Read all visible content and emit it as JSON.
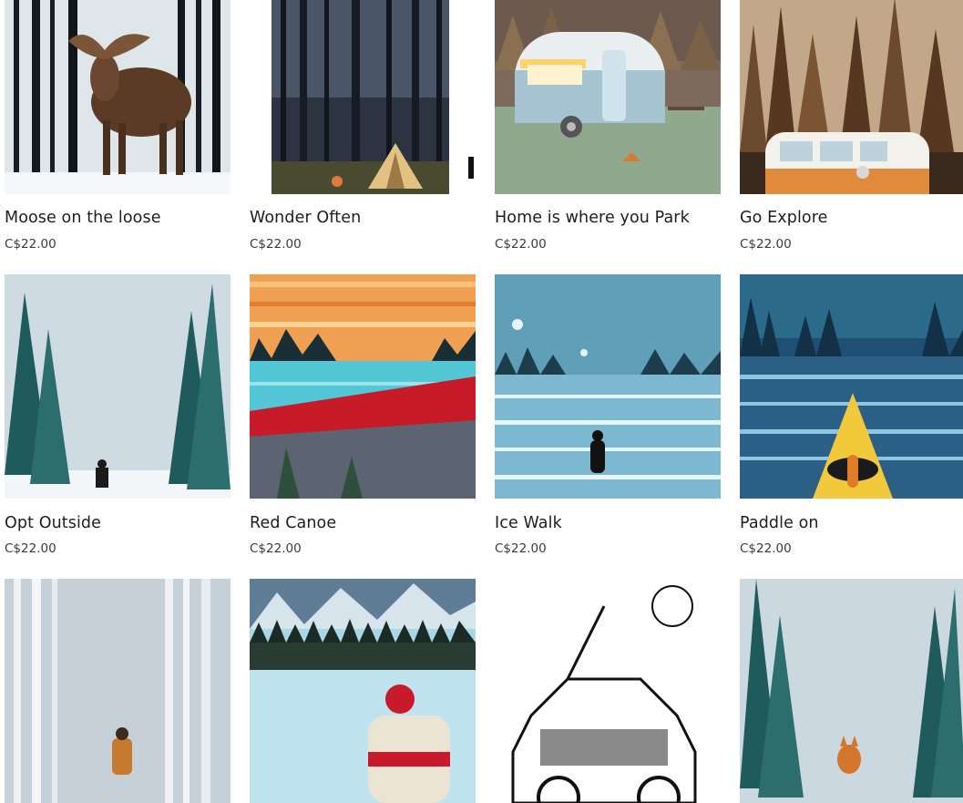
{
  "currency_price": "C$22.00",
  "products": [
    {
      "title": "Moose on the loose",
      "price": "C$22.00",
      "art": "moose"
    },
    {
      "title": "Wonder Often",
      "price": "C$22.00",
      "art": "tent"
    },
    {
      "title": "Home is where you Park",
      "price": "C$22.00",
      "art": "camper"
    },
    {
      "title": "Go Explore",
      "price": "C$22.00",
      "art": "vw-bus"
    },
    {
      "title": "Opt Outside",
      "price": "C$22.00",
      "art": "snowy-trail"
    },
    {
      "title": "Red Canoe",
      "price": "C$22.00",
      "art": "red-canoe"
    },
    {
      "title": "Ice Walk",
      "price": "C$22.00",
      "art": "ice-walk"
    },
    {
      "title": "Paddle on",
      "price": "C$22.00",
      "art": "kayak"
    },
    {
      "title": "",
      "price": "",
      "art": "birch-hiker"
    },
    {
      "title": "",
      "price": "",
      "art": "canada-skater"
    },
    {
      "title": "",
      "price": "",
      "art": "jeep-sketch"
    },
    {
      "title": "",
      "price": "",
      "art": "fox-forest"
    }
  ]
}
